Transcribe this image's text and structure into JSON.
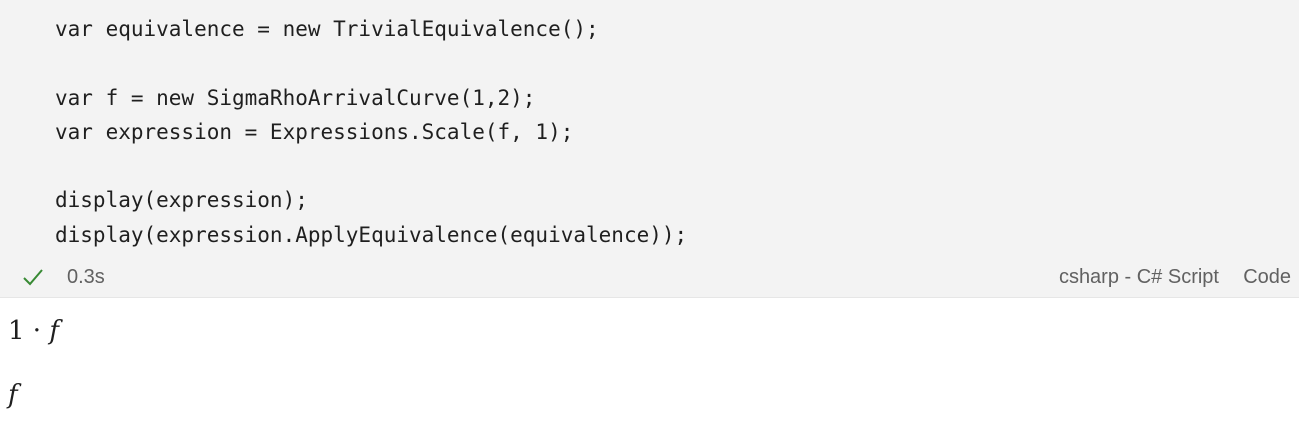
{
  "cell": {
    "code_lines": [
      "var equivalence = new TrivialEquivalence();",
      "",
      "var f = new SigmaRhoArrivalCurve(1,2);",
      "var expression = Expressions.Scale(f, 1);",
      "",
      "display(expression);",
      "display(expression.ApplyEquivalence(equivalence));"
    ]
  },
  "status": {
    "icon": "check-icon",
    "duration": "0.3s",
    "kernel": "csharp - C# Script",
    "language": "Code"
  },
  "outputs": {
    "line1_coef": "1 · ",
    "line1_var": "f",
    "line2_var": "f"
  }
}
